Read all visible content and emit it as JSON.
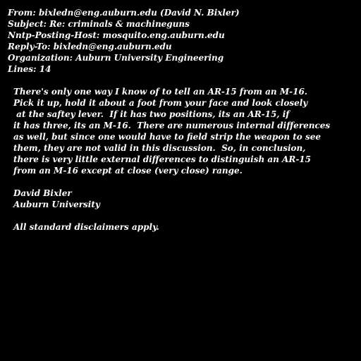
{
  "headers": {
    "from": "From: bixledn@eng.auburn.edu (David N. Bixler)",
    "subject": "Subject: Re: criminals & machineguns",
    "nntp_host": "Nntp-Posting-Host: mosquito.eng.auburn.edu",
    "reply_to": "Reply-To: bixledn@eng.auburn.edu",
    "organization": "Organization: Auburn University Engineering",
    "lines": "Lines: 14"
  },
  "body": {
    "lines": [
      "There's only one way I know of to tell an AR-15 from an M-16.",
      "Pick it up, hold it about a foot from your face and look closely",
      " at the saftey lever.  If it has two positions, its an AR-15, if",
      "it has three, its an M-16.  There are numerous internal differences",
      "as well, but since one would have to field strip the weapon to see",
      "them, they are not valid in this discussion.  So, in conclusion,",
      "there is very little external differences to distinguish an AR-15",
      "from an M-16 except at close (very close) range."
    ]
  },
  "signature": {
    "name": "David Bixler",
    "affiliation": "Auburn University",
    "disclaimer": "All standard disclaimers apply."
  }
}
